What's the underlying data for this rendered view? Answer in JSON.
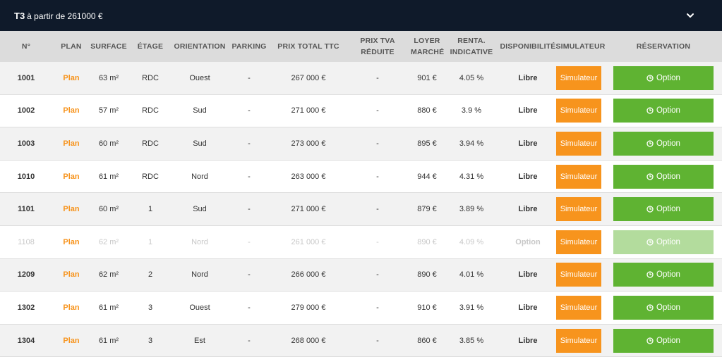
{
  "header": {
    "type_label": "T3",
    "subtitle": "à partir de 261000 €"
  },
  "columns": {
    "num": "N°",
    "plan": "PLAN",
    "surface": "SURFACE",
    "etage": "ÉTAGE",
    "orientation": "ORIENTATION",
    "parking": "PARKING",
    "prix_ttc": "PRIX TOTAL TTC",
    "prix_tva": "PRIX TVA RÉDUITE",
    "loyer_l1": "LOYER",
    "loyer_l2": "MARCHÉ",
    "renta_l1": "RENTA.",
    "renta_l2": "INDICATIVE",
    "dispo": "DISPONIBILITÉ",
    "simulateur": "SIMULATEUR",
    "reservation": "RÉSERVATION"
  },
  "rows": [
    {
      "num": "1001",
      "plan": "Plan",
      "surface": "63 m²",
      "etage": "RDC",
      "orientation": "Ouest",
      "parking": "-",
      "prix": "267 000 €",
      "tva": "-",
      "loyer": "901 €",
      "renta": "4.05 %",
      "dispo": "Libre",
      "sim": "Simulateur",
      "option": "Option",
      "disabled": false
    },
    {
      "num": "1002",
      "plan": "Plan",
      "surface": "57 m²",
      "etage": "RDC",
      "orientation": "Sud",
      "parking": "-",
      "prix": "271 000 €",
      "tva": "-",
      "loyer": "880 €",
      "renta": "3.9 %",
      "dispo": "Libre",
      "sim": "Simulateur",
      "option": "Option",
      "disabled": false
    },
    {
      "num": "1003",
      "plan": "Plan",
      "surface": "60 m²",
      "etage": "RDC",
      "orientation": "Sud",
      "parking": "-",
      "prix": "273 000 €",
      "tva": "-",
      "loyer": "895 €",
      "renta": "3.94 %",
      "dispo": "Libre",
      "sim": "Simulateur",
      "option": "Option",
      "disabled": false
    },
    {
      "num": "1010",
      "plan": "Plan",
      "surface": "61 m²",
      "etage": "RDC",
      "orientation": "Nord",
      "parking": "-",
      "prix": "263 000 €",
      "tva": "-",
      "loyer": "944 €",
      "renta": "4.31 %",
      "dispo": "Libre",
      "sim": "Simulateur",
      "option": "Option",
      "disabled": false
    },
    {
      "num": "1101",
      "plan": "Plan",
      "surface": "60 m²",
      "etage": "1",
      "orientation": "Sud",
      "parking": "-",
      "prix": "271 000 €",
      "tva": "-",
      "loyer": "879 €",
      "renta": "3.89 %",
      "dispo": "Libre",
      "sim": "Simulateur",
      "option": "Option",
      "disabled": false
    },
    {
      "num": "1108",
      "plan": "Plan",
      "surface": "62 m²",
      "etage": "1",
      "orientation": "Nord",
      "parking": "-",
      "prix": "261 000 €",
      "tva": "-",
      "loyer": "890 €",
      "renta": "4.09 %",
      "dispo": "Option",
      "sim": "Simulateur",
      "option": "Option",
      "disabled": true
    },
    {
      "num": "1209",
      "plan": "Plan",
      "surface": "62 m²",
      "etage": "2",
      "orientation": "Nord",
      "parking": "-",
      "prix": "266 000 €",
      "tva": "-",
      "loyer": "890 €",
      "renta": "4.01 %",
      "dispo": "Libre",
      "sim": "Simulateur",
      "option": "Option",
      "disabled": false
    },
    {
      "num": "1302",
      "plan": "Plan",
      "surface": "61 m²",
      "etage": "3",
      "orientation": "Ouest",
      "parking": "-",
      "prix": "279 000 €",
      "tva": "-",
      "loyer": "910 €",
      "renta": "3.91 %",
      "dispo": "Libre",
      "sim": "Simulateur",
      "option": "Option",
      "disabled": false
    },
    {
      "num": "1304",
      "plan": "Plan",
      "surface": "61 m²",
      "etage": "3",
      "orientation": "Est",
      "parking": "-",
      "prix": "268 000 €",
      "tva": "-",
      "loyer": "860 €",
      "renta": "3.85 %",
      "dispo": "Libre",
      "sim": "Simulateur",
      "option": "Option",
      "disabled": false
    }
  ],
  "colors": {
    "header_bg": "#0f1a2a",
    "plan_orange": "#f7941d",
    "simulateur_orange": "#f7941d",
    "option_green": "#5fb332",
    "option_green_faded": "#b3dc9d"
  },
  "icons": {
    "header_toggle": "chevron-down-icon",
    "option_button": "clock-icon"
  }
}
